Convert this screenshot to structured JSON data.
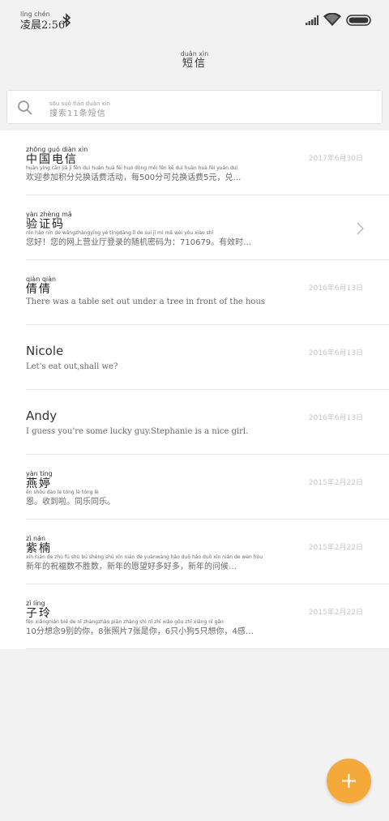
{
  "status_bar": {
    "time_ruby": "líng chén",
    "time": "凌晨2:56"
  },
  "header": {
    "title_ruby": "duǎn xìn",
    "title": "短信"
  },
  "search": {
    "placeholder_ruby": "sōu suǒ      tiáo duǎn xìn",
    "placeholder": "搜索11条短信"
  },
  "messages": [
    {
      "name_ruby": "zhōng guó diàn xìn",
      "name": "中国电信",
      "snippet_ruby": "huān yíng cān  jiā   jī  fēn  duì huàn huà  fèi  huó dòng        měi          fēn  kě  duì huàn huà  fèi   yuán        duì",
      "snippet": "欢迎参加积分兑换话费活动，每500分可兑换话费5元，兑…",
      "time": "2017年6月30日"
    },
    {
      "name_ruby": "yàn zhèng mǎ",
      "name": "验证码",
      "snippet_ruby": "nín  hǎo        nín  de  wǎngzhàngyīng  yè   tíngdāng  lǐ   de  suí   jī    mì   mǎ  wèi                       yǒu xiào shí",
      "snippet": "您好！您的网上营业厅登录的随机密码为：710679。有效时…",
      "time": ""
    },
    {
      "name_ruby": "qiàn qiàn",
      "name": "倩倩",
      "snippet_ruby": "",
      "snippet": "There was a table set out under a tree in front of the hous",
      "time": "2016年6月13日"
    },
    {
      "name_ruby": "",
      "name": "Nicole",
      "snippet_ruby": "",
      "snippet": "Let's eat out,shall we?",
      "time": "2016年6月13日"
    },
    {
      "name_ruby": "",
      "name": "Andy",
      "snippet_ruby": "",
      "snippet": "I guess you're some lucky guy.Stephanie is a nice girl.",
      "time": "2016年6月13日"
    },
    {
      "name_ruby": "yàn tíng",
      "name": "燕婷",
      "snippet_ruby": "ēn      shōu dào  le     tóng  lè  tóng  lè",
      "snippet": "恩。收到啦。同乐同乐。",
      "time": "2015年2月22日"
    },
    {
      "name_ruby": "zǐ  nán",
      "name": "紫楠",
      "snippet_ruby": "xīn nián  de  zhù  fú  shù  bú  shèng shǔ        xīn  nián  de  yuànwàng hǎo  duō hǎo  duō        xīn  nián  de  wèn hòu",
      "snippet": "新年的祝福数不胜数，新年的愿望好多好多，新年的问候…",
      "time": "2015年2月22日"
    },
    {
      "name_ruby": "zǐ  líng",
      "name": "子玲",
      "snippet_ruby": "      fēn xiǎngnián  bié  de  nǐ       zhàngzhào piān  zhàng shì   nǐ        zhī  xiǎo gǒu  zhī xiǎng nǐ         gǎn",
      "snippet": "10分想念9别的你，8张照片7张是你，6只小狗5只想你，4感…",
      "time": "2015年2月22日"
    }
  ],
  "fab": {
    "label": "+"
  }
}
